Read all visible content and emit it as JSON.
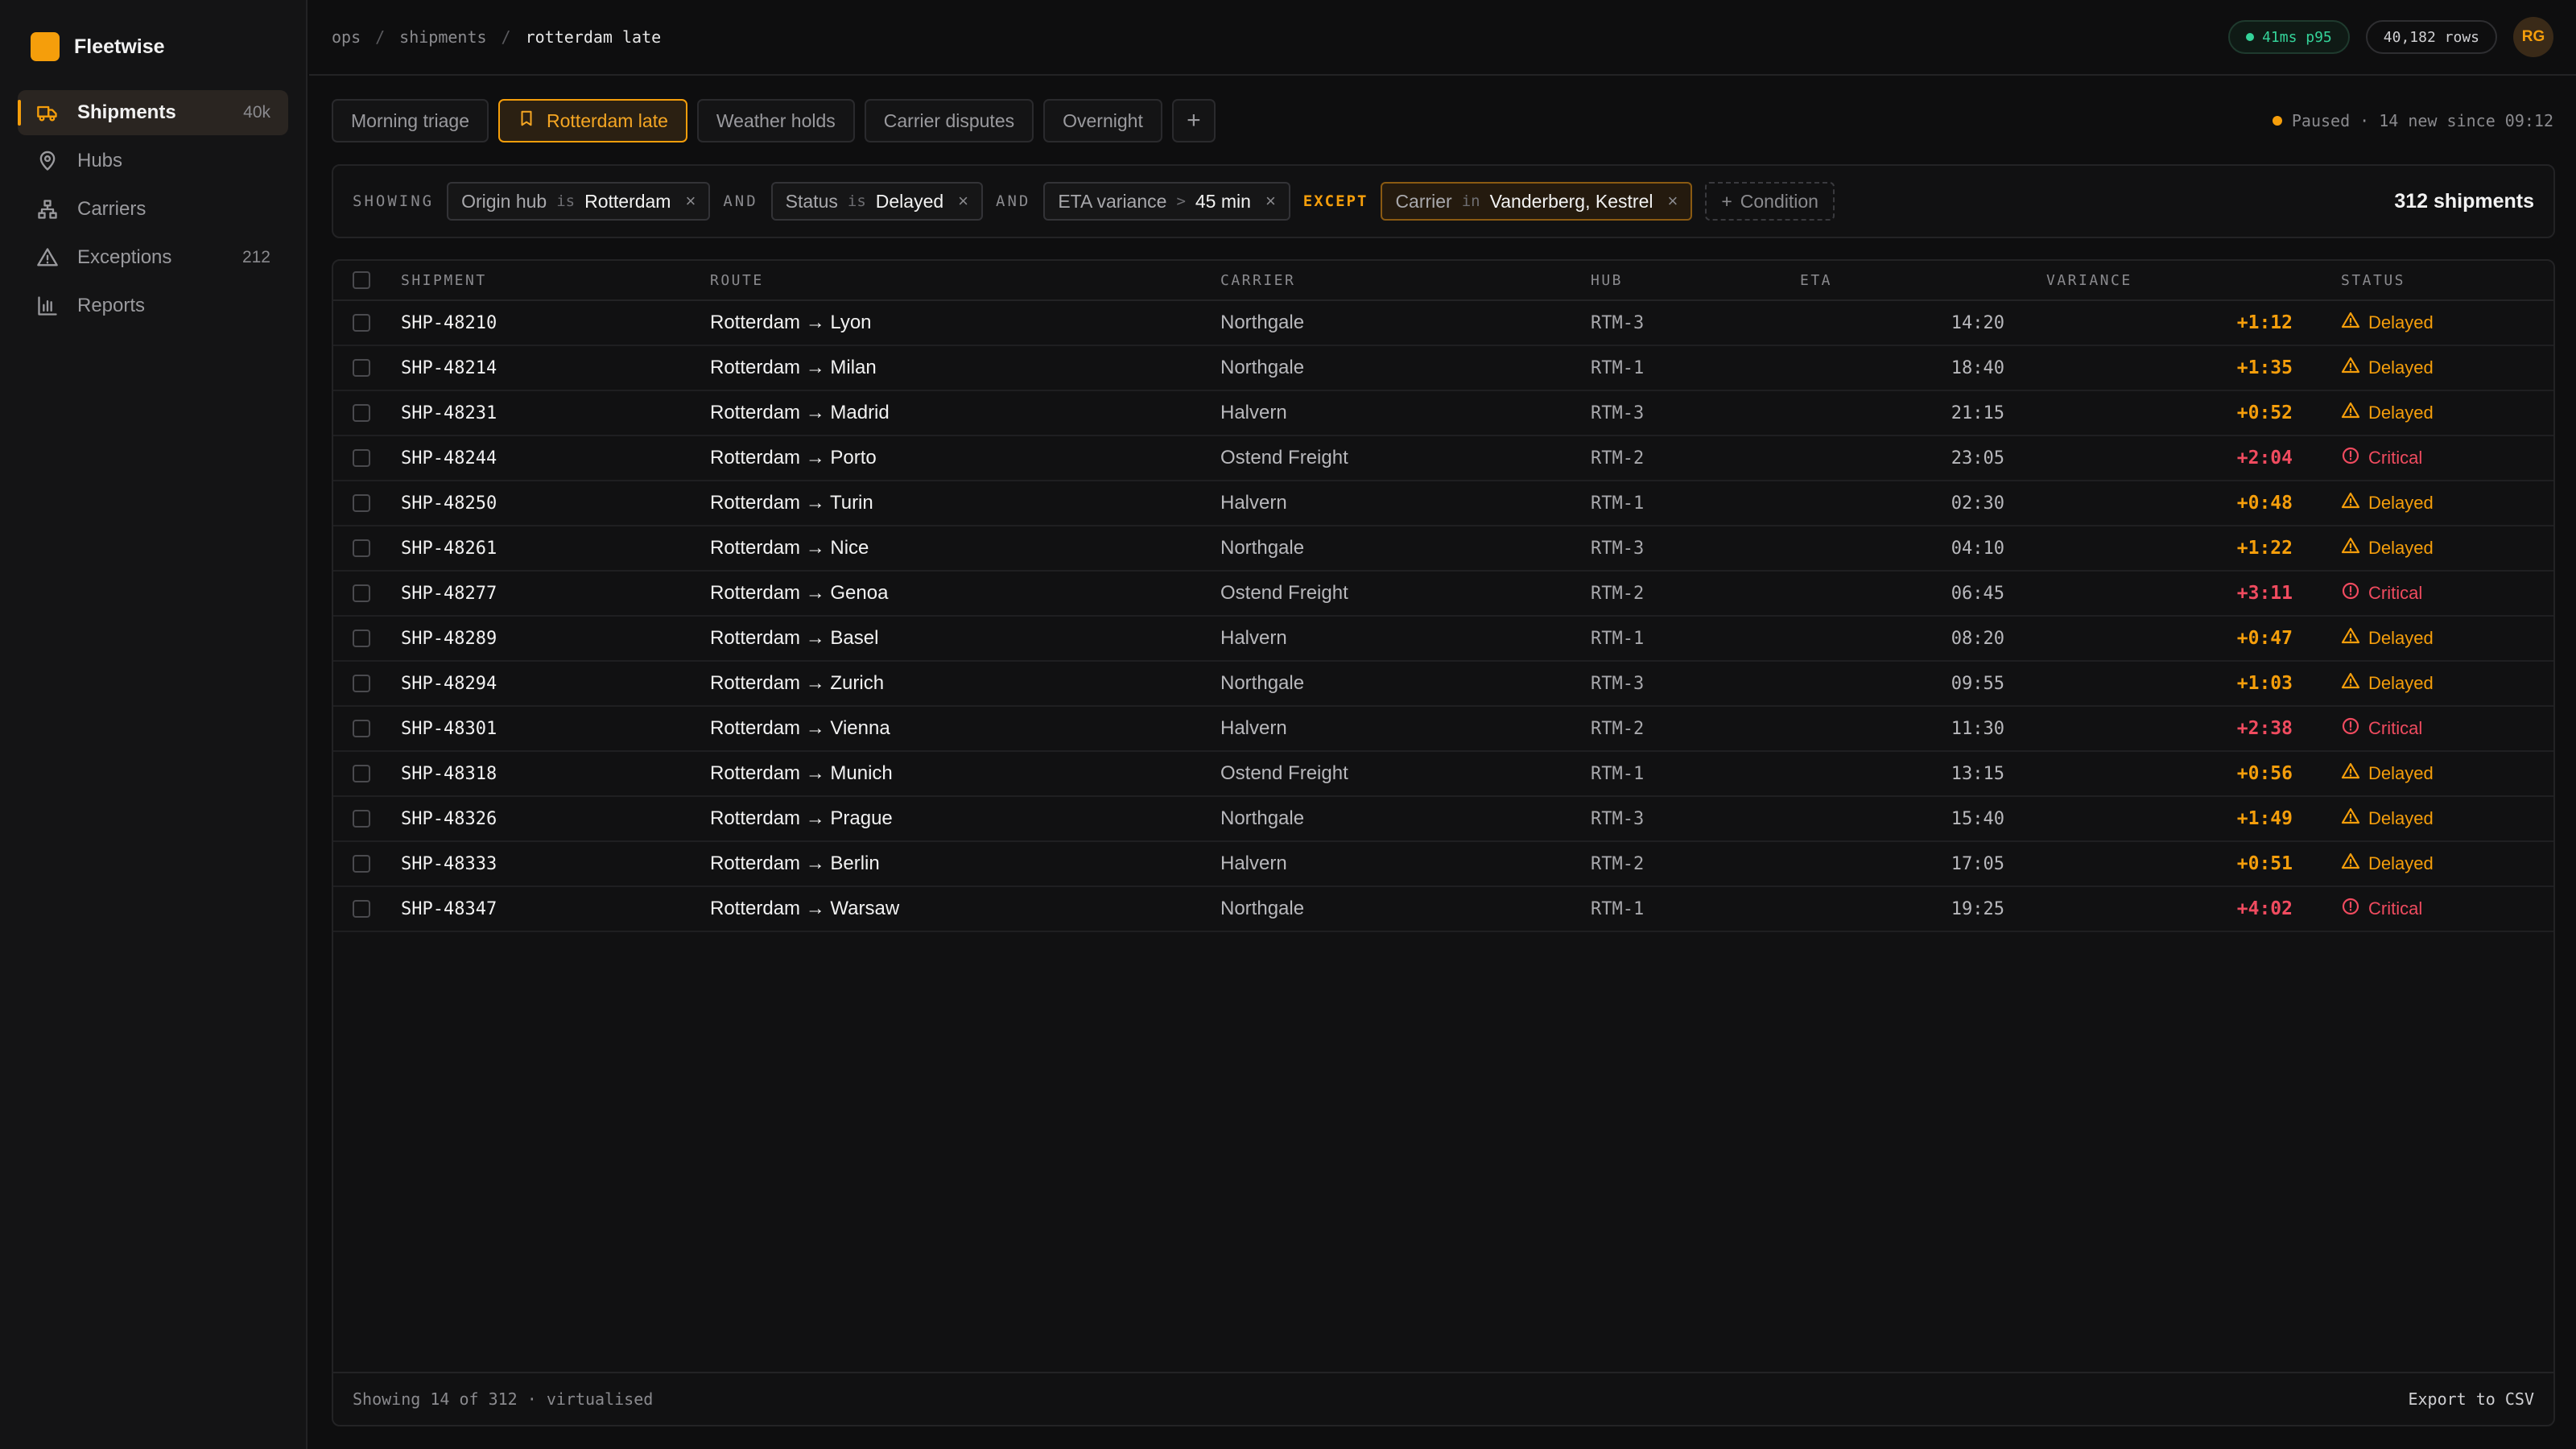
{
  "app": {
    "name": "Fleetwise",
    "accent": "#f59e0b"
  },
  "sidebar": {
    "items": [
      {
        "label": "Shipments",
        "count": "40k",
        "icon": "truck-icon",
        "active": true
      },
      {
        "label": "Hubs",
        "count": "",
        "icon": "map-pin-icon",
        "active": false
      },
      {
        "label": "Carriers",
        "count": "",
        "icon": "network-icon",
        "active": false
      },
      {
        "label": "Exceptions",
        "count": "212",
        "icon": "warning-icon",
        "active": false
      },
      {
        "label": "Reports",
        "count": "",
        "icon": "bar-chart-icon",
        "active": false
      }
    ]
  },
  "breadcrumb": {
    "items": [
      "ops",
      "shipments",
      "rotterdam late"
    ],
    "separator": "/"
  },
  "header": {
    "latency": "41ms p95",
    "rows": "40,182 rows",
    "avatar": "RG"
  },
  "tabs": {
    "items": [
      "Morning triage",
      "Rotterdam late",
      "Weather holds",
      "Carrier disputes",
      "Overnight"
    ],
    "active": "Rotterdam late",
    "add": "+"
  },
  "live": {
    "text": "Paused · 14 new since 09:12"
  },
  "filters": {
    "showing": "SHOWING",
    "and": "AND",
    "except": "EXCEPT",
    "conditions": [
      {
        "field": "Origin hub",
        "op": "is",
        "value": "Rotterdam"
      },
      {
        "field": "Status",
        "op": "is",
        "value": "Delayed"
      },
      {
        "field": "ETA variance",
        "op": ">",
        "value": "45 min"
      }
    ],
    "exception": {
      "field": "Carrier",
      "op": "in",
      "value": "Vanderberg, Kestrel"
    },
    "add_condition": "Condition",
    "total": "312 shipments"
  },
  "table": {
    "columns": [
      "SHIPMENT",
      "ROUTE",
      "CARRIER",
      "HUB",
      "ETA",
      "VARIANCE",
      "STATUS"
    ],
    "rows": [
      {
        "id": "SHP-48210",
        "route": "Rotterdam → Lyon",
        "carrier": "Northgale",
        "hub": "RTM-3",
        "eta": "14:20",
        "variance": "+1:12",
        "status": "Delayed"
      },
      {
        "id": "SHP-48214",
        "route": "Rotterdam → Milan",
        "carrier": "Northgale",
        "hub": "RTM-1",
        "eta": "18:40",
        "variance": "+1:35",
        "status": "Delayed"
      },
      {
        "id": "SHP-48231",
        "route": "Rotterdam → Madrid",
        "carrier": "Halvern",
        "hub": "RTM-3",
        "eta": "21:15",
        "variance": "+0:52",
        "status": "Delayed"
      },
      {
        "id": "SHP-48244",
        "route": "Rotterdam → Porto",
        "carrier": "Ostend Freight",
        "hub": "RTM-2",
        "eta": "23:05",
        "variance": "+2:04",
        "status": "Critical"
      },
      {
        "id": "SHP-48250",
        "route": "Rotterdam → Turin",
        "carrier": "Halvern",
        "hub": "RTM-1",
        "eta": "02:30",
        "variance": "+0:48",
        "status": "Delayed"
      },
      {
        "id": "SHP-48261",
        "route": "Rotterdam → Nice",
        "carrier": "Northgale",
        "hub": "RTM-3",
        "eta": "04:10",
        "variance": "+1:22",
        "status": "Delayed"
      },
      {
        "id": "SHP-48277",
        "route": "Rotterdam → Genoa",
        "carrier": "Ostend Freight",
        "hub": "RTM-2",
        "eta": "06:45",
        "variance": "+3:11",
        "status": "Critical"
      },
      {
        "id": "SHP-48289",
        "route": "Rotterdam → Basel",
        "carrier": "Halvern",
        "hub": "RTM-1",
        "eta": "08:20",
        "variance": "+0:47",
        "status": "Delayed"
      },
      {
        "id": "SHP-48294",
        "route": "Rotterdam → Zurich",
        "carrier": "Northgale",
        "hub": "RTM-3",
        "eta": "09:55",
        "variance": "+1:03",
        "status": "Delayed"
      },
      {
        "id": "SHP-48301",
        "route": "Rotterdam → Vienna",
        "carrier": "Halvern",
        "hub": "RTM-2",
        "eta": "11:30",
        "variance": "+2:38",
        "status": "Critical"
      },
      {
        "id": "SHP-48318",
        "route": "Rotterdam → Munich",
        "carrier": "Ostend Freight",
        "hub": "RTM-1",
        "eta": "13:15",
        "variance": "+0:56",
        "status": "Delayed"
      },
      {
        "id": "SHP-48326",
        "route": "Rotterdam → Prague",
        "carrier": "Northgale",
        "hub": "RTM-3",
        "eta": "15:40",
        "variance": "+1:49",
        "status": "Delayed"
      },
      {
        "id": "SHP-48333",
        "route": "Rotterdam → Berlin",
        "carrier": "Halvern",
        "hub": "RTM-2",
        "eta": "17:05",
        "variance": "+0:51",
        "status": "Delayed"
      },
      {
        "id": "SHP-48347",
        "route": "Rotterdam → Warsaw",
        "carrier": "Northgale",
        "hub": "RTM-1",
        "eta": "19:25",
        "variance": "+4:02",
        "status": "Critical"
      }
    ],
    "footer": "Showing 14 of 312 · virtualised",
    "export": "Export to CSV"
  },
  "colors": {
    "delayed": "#f59e0b",
    "critical": "#f04b5f",
    "ok": "#34d399"
  }
}
